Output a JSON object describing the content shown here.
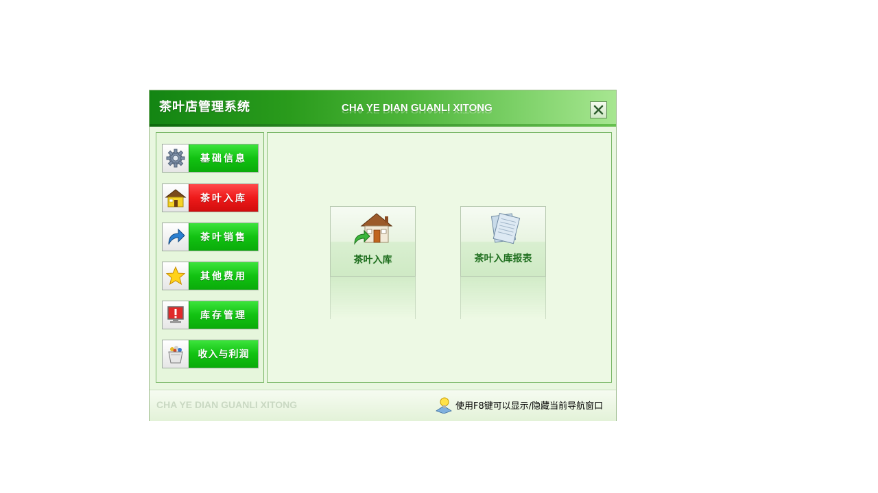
{
  "window": {
    "title_cn": "茶叶店管理系统",
    "title_en": "CHA YE DIAN GUANLI XITONG",
    "close_icon": "close-x-icon"
  },
  "sidebar": {
    "items": [
      {
        "label": "基础信息",
        "icon": "gear-icon",
        "active": false
      },
      {
        "label": "茶叶入库",
        "icon": "house-icon",
        "active": true
      },
      {
        "label": "茶叶销售",
        "icon": "arrow-icon",
        "active": false
      },
      {
        "label": "其他费用",
        "icon": "star-icon",
        "active": false
      },
      {
        "label": "库存管理",
        "icon": "monitor-alert-icon",
        "active": false
      },
      {
        "label": "收入与利润",
        "icon": "coin-bucket-icon",
        "active": false
      }
    ]
  },
  "main": {
    "tiles": [
      {
        "label": "茶叶入库",
        "icon": "house-arrow-icon"
      },
      {
        "label": "茶叶入库报表",
        "icon": "documents-icon"
      }
    ]
  },
  "statusbar": {
    "watermark": "CHA YE DIAN GUANLI XITONG",
    "tip": "使用F8键可以显示/隐藏当前导航窗口",
    "tip_icon": "lightbulb-icon"
  },
  "colors": {
    "title_green": "#138513",
    "nav_green": "#12c212",
    "nav_active_red": "#ee1a1a",
    "tile_label_green": "#1e6e1e",
    "background": "#e9f7e0"
  }
}
